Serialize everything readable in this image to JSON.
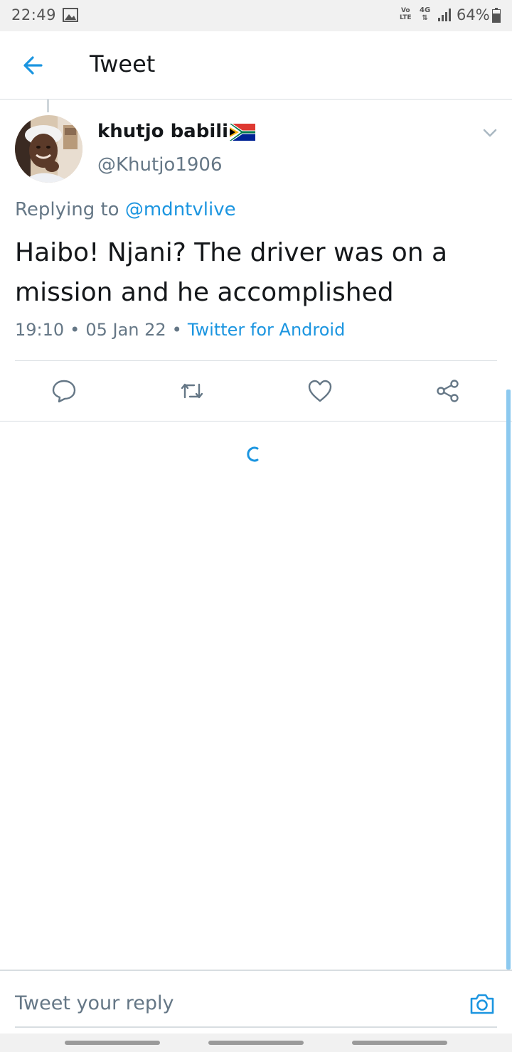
{
  "status_bar": {
    "time": "22:49",
    "volte": "Vo LTE",
    "network": "4G",
    "battery": "64%"
  },
  "header": {
    "title": "Tweet",
    "back_icon": "arrow-left-icon"
  },
  "tweet": {
    "display_name": "khutjo babili",
    "flag_icon": "south-africa-flag",
    "handle": "@Khutjo1906",
    "replying_prefix": "Replying to",
    "replying_to": "@mdntvlive",
    "text": "Haibo! Njani? The driver was on a mission and he accomplished",
    "time": "19:10",
    "date": "05 Jan 22",
    "separator": "•",
    "source": "Twitter for Android",
    "actions": [
      "reply-icon",
      "retweet-icon",
      "like-icon",
      "share-icon"
    ]
  },
  "composer": {
    "placeholder": "Tweet your reply",
    "camera_icon": "camera-icon"
  },
  "colors": {
    "accent": "#1b95e0",
    "secondary_text": "#657786",
    "divider": "#d8dde1"
  }
}
